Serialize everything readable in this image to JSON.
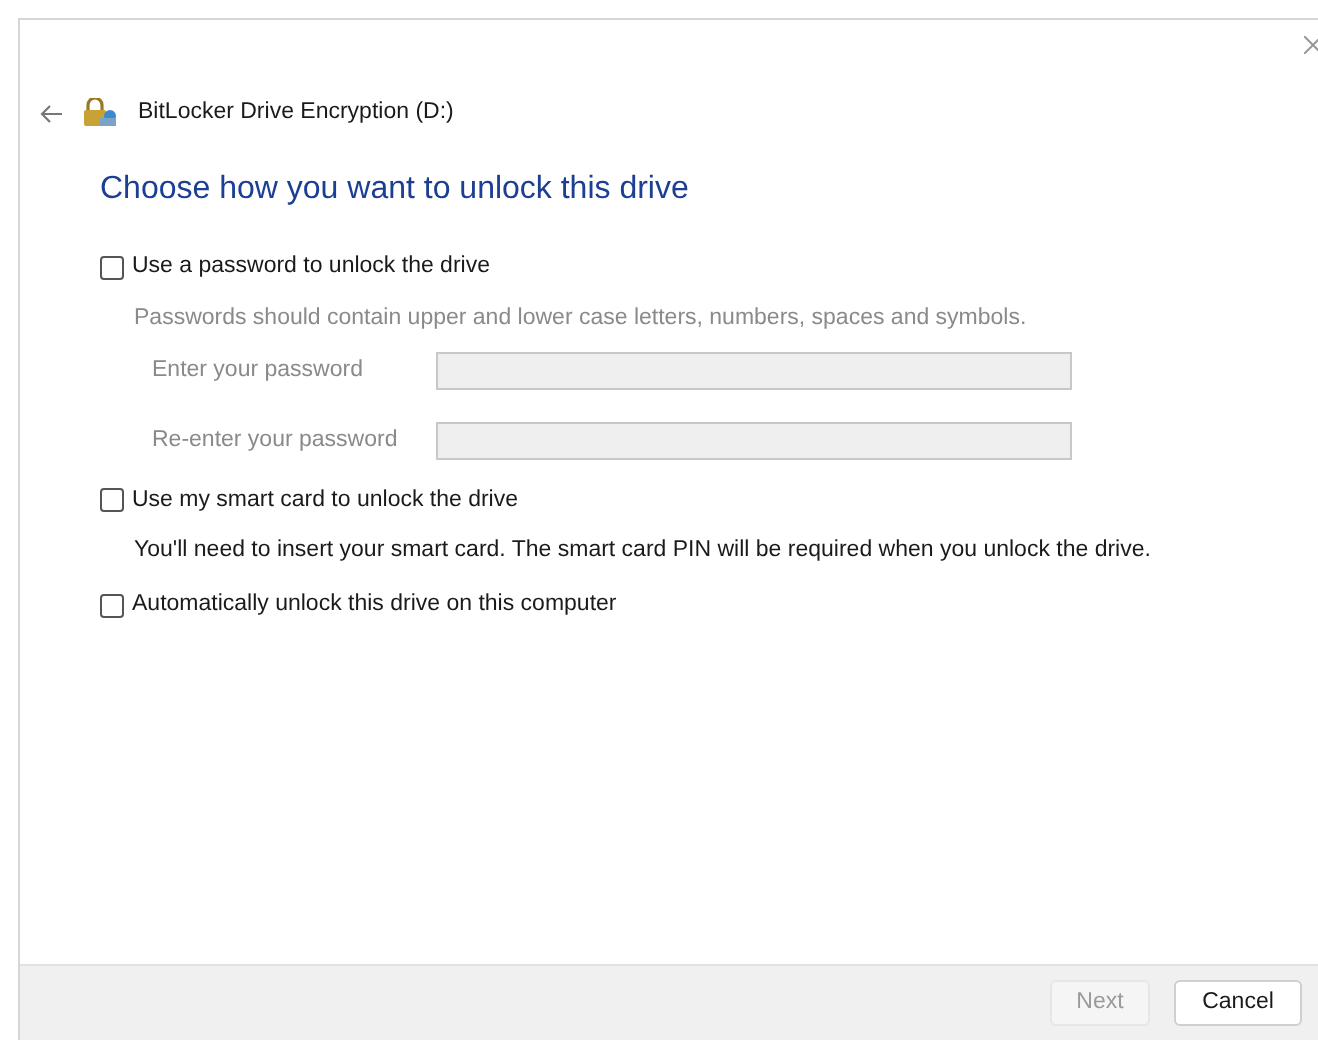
{
  "window": {
    "title": "BitLocker Drive Encryption (D:)"
  },
  "heading": "Choose how you want to unlock this drive",
  "options": [
    {
      "kind": "checkbox",
      "label": "Use a password to unlock the drive",
      "checked": false,
      "note": {
        "text": "Passwords should contain upper and lower case letters, numbers, spaces and symbols.",
        "disabled": true
      },
      "fields": [
        {
          "label": "Enter your password",
          "disabled": true
        },
        {
          "label": "Re-enter your password",
          "disabled": true
        }
      ]
    },
    {
      "kind": "checkbox",
      "label": "Use my smart card to unlock the drive",
      "checked": false,
      "note": {
        "text": "You'll need to insert your smart card. The smart card PIN will be required when you unlock the drive.",
        "disabled": false
      }
    },
    {
      "kind": "checkbox",
      "label": "Automatically unlock this drive on this computer",
      "checked": false
    }
  ],
  "buttons": [
    {
      "label": "Next",
      "disabled": true
    },
    {
      "label": "Cancel",
      "disabled": false
    }
  ]
}
